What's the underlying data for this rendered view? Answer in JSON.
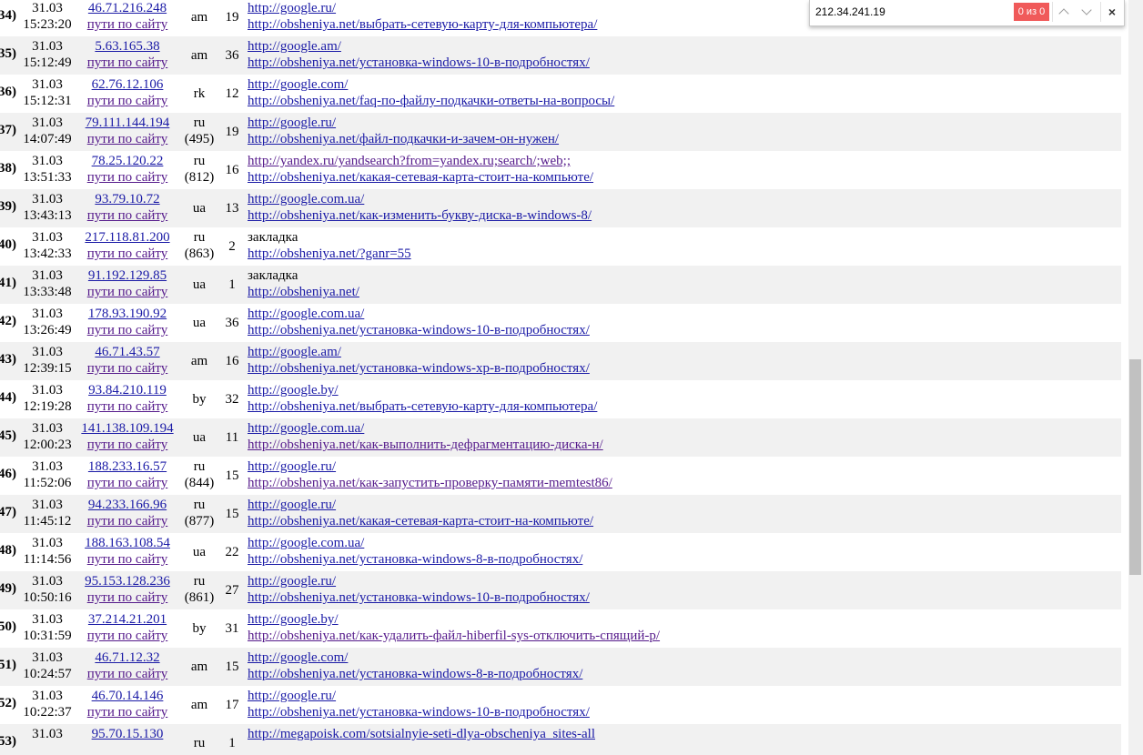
{
  "find_bar": {
    "query": "212.34.241.19",
    "count": "0 из 0",
    "prev_icon": "chevron-up-icon",
    "next_icon": "chevron-down-icon",
    "close_icon": "×"
  },
  "visits": [
    {
      "num": "34)",
      "date": "31.03",
      "time": "15:23:20",
      "ip": "46.71.216.248",
      "paths": "пути по сайту",
      "cc": "am",
      "code": "",
      "count": "19",
      "ref": "http://google.ru/",
      "ref_link": true,
      "ref_visited": false,
      "landing": "http://obsheniya.net/выбрать-сетевую-карту-для-компьютера/",
      "landing_visited": false
    },
    {
      "num": "35)",
      "date": "31.03",
      "time": "15:12:49",
      "ip": "5.63.165.38",
      "paths": "пути по сайту",
      "cc": "am",
      "code": "",
      "count": "36",
      "ref": "http://google.am/",
      "ref_link": true,
      "ref_visited": false,
      "landing": "http://obsheniya.net/установка-windows-10-в-подробностях/",
      "landing_visited": false
    },
    {
      "num": "36)",
      "date": "31.03",
      "time": "15:12:31",
      "ip": "62.76.12.106",
      "paths": "пути по сайту",
      "cc": "rk",
      "code": "",
      "count": "12",
      "ref": "http://google.com/",
      "ref_link": true,
      "ref_visited": false,
      "landing": "http://obsheniya.net/faq-по-файлу-подкачки-ответы-на-вопросы/",
      "landing_visited": false
    },
    {
      "num": "37)",
      "date": "31.03",
      "time": "14:07:49",
      "ip": "79.111.144.194",
      "paths": "пути по сайту",
      "cc": "ru",
      "code": "(495)",
      "count": "19",
      "ref": "http://google.ru/",
      "ref_link": true,
      "ref_visited": false,
      "landing": "http://obsheniya.net/файл-подкачки-и-зачем-он-нужен/",
      "landing_visited": false
    },
    {
      "num": "38)",
      "date": "31.03",
      "time": "13:51:33",
      "ip": "78.25.120.22",
      "paths": "пути по сайту",
      "cc": "ru",
      "code": "(812)",
      "count": "16",
      "ref": "http://yandex.ru/yandsearch?from=yandex.ru;search/;web;;",
      "ref_link": true,
      "ref_visited": true,
      "landing": "http://obsheniya.net/какая-сетевая-карта-стоит-на-компьюте/",
      "landing_visited": false
    },
    {
      "num": "39)",
      "date": "31.03",
      "time": "13:43:13",
      "ip": "93.79.10.72",
      "paths": "пути по сайту",
      "cc": "ua",
      "code": "",
      "count": "13",
      "ref": "http://google.com.ua/",
      "ref_link": true,
      "ref_visited": false,
      "landing": "http://obsheniya.net/как-изменить-букву-диска-в-windows-8/",
      "landing_visited": false
    },
    {
      "num": "40)",
      "date": "31.03",
      "time": "13:42:33",
      "ip": "217.118.81.200",
      "paths": "пути по сайту",
      "cc": "ru",
      "code": "(863)",
      "count": "2",
      "ref": "закладка",
      "ref_link": false,
      "ref_visited": false,
      "landing": "http://obsheniya.net/?ganr=55",
      "landing_visited": false
    },
    {
      "num": "41)",
      "date": "31.03",
      "time": "13:33:48",
      "ip": "91.192.129.85",
      "paths": "пути по сайту",
      "cc": "ua",
      "code": "",
      "count": "1",
      "ref": "закладка",
      "ref_link": false,
      "ref_visited": false,
      "landing": "http://obsheniya.net/",
      "landing_visited": false
    },
    {
      "num": "42)",
      "date": "31.03",
      "time": "13:26:49",
      "ip": "178.93.190.92",
      "paths": "пути по сайту",
      "cc": "ua",
      "code": "",
      "count": "36",
      "ref": "http://google.com.ua/",
      "ref_link": true,
      "ref_visited": false,
      "landing": "http://obsheniya.net/установка-windows-10-в-подробностях/",
      "landing_visited": false
    },
    {
      "num": "43)",
      "date": "31.03",
      "time": "12:39:15",
      "ip": "46.71.43.57",
      "paths": "пути по сайту",
      "cc": "am",
      "code": "",
      "count": "16",
      "ref": "http://google.am/",
      "ref_link": true,
      "ref_visited": false,
      "landing": "http://obsheniya.net/установка-windows-xp-в-подробностях/",
      "landing_visited": false
    },
    {
      "num": "44)",
      "date": "31.03",
      "time": "12:19:28",
      "ip": "93.84.210.119",
      "paths": "пути по сайту",
      "cc": "by",
      "code": "",
      "count": "32",
      "ref": "http://google.by/",
      "ref_link": true,
      "ref_visited": false,
      "landing": "http://obsheniya.net/выбрать-сетевую-карту-для-компьютера/",
      "landing_visited": false
    },
    {
      "num": "45)",
      "date": "31.03",
      "time": "12:00:23",
      "ip": "141.138.109.194",
      "paths": "пути по сайту",
      "cc": "ua",
      "code": "",
      "count": "11",
      "ref": "http://google.com.ua/",
      "ref_link": true,
      "ref_visited": false,
      "landing": "http://obsheniya.net/как-выполнить-дефрагментацию-диска-н/",
      "landing_visited": true
    },
    {
      "num": "46)",
      "date": "31.03",
      "time": "11:52:06",
      "ip": "188.233.16.57",
      "paths": "пути по сайту",
      "cc": "ru",
      "code": "(844)",
      "count": "15",
      "ref": "http://google.ru/",
      "ref_link": true,
      "ref_visited": false,
      "landing": "http://obsheniya.net/как-запустить-проверку-памяти-memtest86/",
      "landing_visited": true
    },
    {
      "num": "47)",
      "date": "31.03",
      "time": "11:45:12",
      "ip": "94.233.166.96",
      "paths": "пути по сайту",
      "cc": "ru",
      "code": "(877)",
      "count": "15",
      "ref": "http://google.ru/",
      "ref_link": true,
      "ref_visited": false,
      "landing": "http://obsheniya.net/какая-сетевая-карта-стоит-на-компьюте/",
      "landing_visited": false
    },
    {
      "num": "48)",
      "date": "31.03",
      "time": "11:14:56",
      "ip": "188.163.108.54",
      "paths": "пути по сайту",
      "cc": "ua",
      "code": "",
      "count": "22",
      "ref": "http://google.com.ua/",
      "ref_link": true,
      "ref_visited": false,
      "landing": "http://obsheniya.net/установка-windows-8-в-подробностях/",
      "landing_visited": false
    },
    {
      "num": "49)",
      "date": "31.03",
      "time": "10:50:16",
      "ip": "95.153.128.236",
      "paths": "пути по сайту",
      "cc": "ru",
      "code": "(861)",
      "count": "27",
      "ref": "http://google.ru/",
      "ref_link": true,
      "ref_visited": false,
      "landing": "http://obsheniya.net/установка-windows-10-в-подробностях/",
      "landing_visited": false
    },
    {
      "num": "50)",
      "date": "31.03",
      "time": "10:31:59",
      "ip": "37.214.21.201",
      "paths": "пути по сайту",
      "cc": "by",
      "code": "",
      "count": "31",
      "ref": "http://google.by/",
      "ref_link": true,
      "ref_visited": false,
      "landing": "http://obsheniya.net/как-удалить-файл-hiberfil-sys-отключить-спящий-р/",
      "landing_visited": true
    },
    {
      "num": "51)",
      "date": "31.03",
      "time": "10:24:57",
      "ip": "46.71.12.32",
      "paths": "пути по сайту",
      "cc": "am",
      "code": "",
      "count": "15",
      "ref": "http://google.com/",
      "ref_link": true,
      "ref_visited": false,
      "landing": "http://obsheniya.net/установка-windows-8-в-подробностях/",
      "landing_visited": false
    },
    {
      "num": "52)",
      "date": "31.03",
      "time": "10:22:37",
      "ip": "46.70.14.146",
      "paths": "пути по сайту",
      "cc": "am",
      "code": "",
      "count": "17",
      "ref": "http://google.ru/",
      "ref_link": true,
      "ref_visited": false,
      "landing": "http://obsheniya.net/установка-windows-10-в-подробностях/",
      "landing_visited": false
    },
    {
      "num": "53)",
      "date": "31.03",
      "time": "",
      "ip": "95.70.15.130",
      "paths": "",
      "cc": "ru",
      "code": "",
      "count": "1",
      "ref": "http://megapoisk.com/sotsialnyie-seti-dlya-obscheniya_sites-all",
      "ref_link": true,
      "ref_visited": false,
      "landing": "",
      "landing_visited": false
    }
  ],
  "colors": {
    "link": "#1a1aa6",
    "visited": "#551a8b",
    "row_shade": "#f1f1f1",
    "find_no_match": "#f05a5a"
  }
}
